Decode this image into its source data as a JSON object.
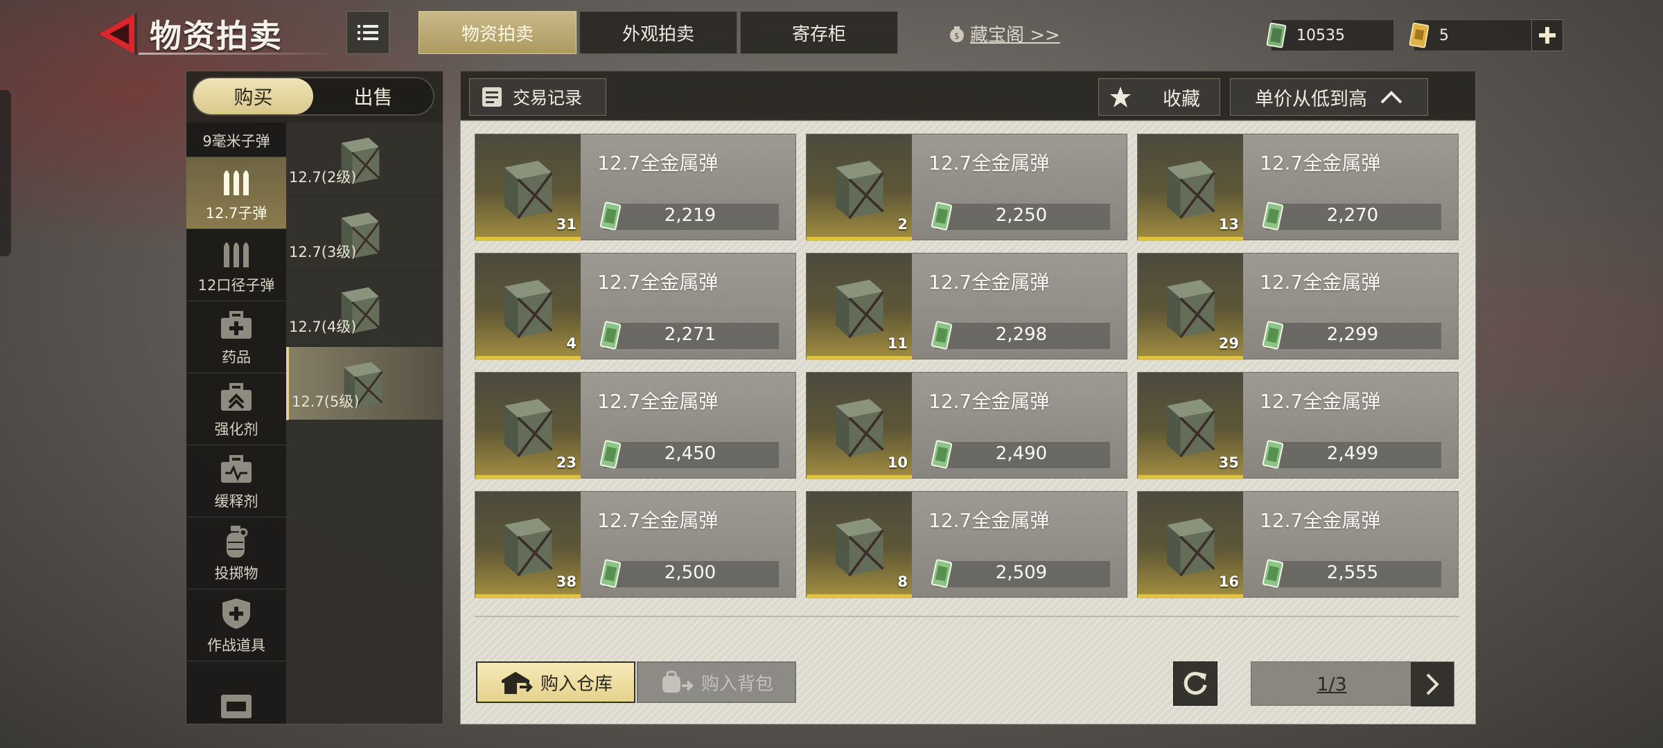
{
  "header": {
    "title": "物资拍卖",
    "tabs": [
      {
        "label": "物资拍卖",
        "active": true
      },
      {
        "label": "外观拍卖",
        "active": false
      },
      {
        "label": "寄存柜",
        "active": false
      }
    ],
    "treasure_link": "藏宝阁 >>",
    "currencies": {
      "cash_amount": "10535",
      "ticket_amount": "5"
    }
  },
  "left_panel": {
    "buy_label": "购买",
    "sell_label": "出售",
    "categories": [
      {
        "label": "9毫米子弹",
        "icon": "bullets-icon",
        "active": false
      },
      {
        "label": "12.7子弹",
        "icon": "bullets-icon",
        "active": true
      },
      {
        "label": "12口径子弹",
        "icon": "bullets-icon",
        "active": false
      },
      {
        "label": "药品",
        "icon": "medkit-icon",
        "active": false
      },
      {
        "label": "强化剂",
        "icon": "booster-box-icon",
        "active": false
      },
      {
        "label": "缓释剂",
        "icon": "heartbeat-box-icon",
        "active": false
      },
      {
        "label": "投掷物",
        "icon": "grenade-icon",
        "active": false
      },
      {
        "label": "作战道具",
        "icon": "shield-plus-icon",
        "active": false
      },
      {
        "label": "",
        "icon": "crate-icon",
        "active": false
      }
    ],
    "subcategories": [
      {
        "label": "12.7(2级)",
        "active": false
      },
      {
        "label": "12.7(3级)",
        "active": false
      },
      {
        "label": "12.7(4级)",
        "active": false
      },
      {
        "label": "12.7(5级)",
        "active": true
      }
    ]
  },
  "toolbar": {
    "trade_log_label": "交易记录",
    "favorite_label": "收藏",
    "sort_label": "单价从低到高"
  },
  "listings": [
    {
      "name": "12.7全金属弹",
      "qty": "31",
      "price": "2,219"
    },
    {
      "name": "12.7全金属弹",
      "qty": "2",
      "price": "2,250"
    },
    {
      "name": "12.7全金属弹",
      "qty": "13",
      "price": "2,270"
    },
    {
      "name": "12.7全金属弹",
      "qty": "4",
      "price": "2,271"
    },
    {
      "name": "12.7全金属弹",
      "qty": "11",
      "price": "2,298"
    },
    {
      "name": "12.7全金属弹",
      "qty": "29",
      "price": "2,299"
    },
    {
      "name": "12.7全金属弹",
      "qty": "23",
      "price": "2,450"
    },
    {
      "name": "12.7全金属弹",
      "qty": "10",
      "price": "2,490"
    },
    {
      "name": "12.7全金属弹",
      "qty": "35",
      "price": "2,499"
    },
    {
      "name": "12.7全金属弹",
      "qty": "38",
      "price": "2,500"
    },
    {
      "name": "12.7全金属弹",
      "qty": "8",
      "price": "2,509"
    },
    {
      "name": "12.7全金属弹",
      "qty": "16",
      "price": "2,555"
    }
  ],
  "footer": {
    "buy_warehouse_label": "购入仓库",
    "buy_backpack_label": "购入背包",
    "page_indicator": "1/3"
  },
  "colors": {
    "accent_gold": "#e3c140",
    "active_tab": "#c9b98a",
    "back_arrow_red": "#d8262b"
  }
}
